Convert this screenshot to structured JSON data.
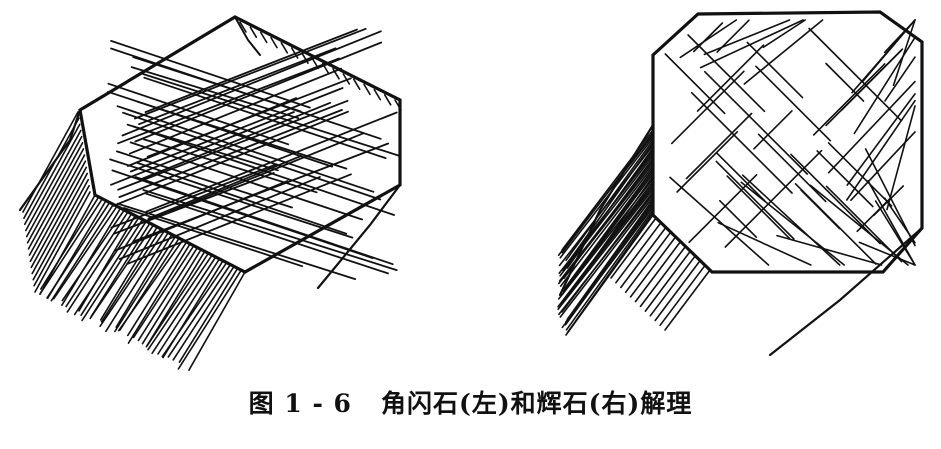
{
  "caption": "图 1 - 6   角闪石(左)和辉石(右)解理",
  "colors": {
    "ink": "#111111",
    "background": "#ffffff"
  }
}
